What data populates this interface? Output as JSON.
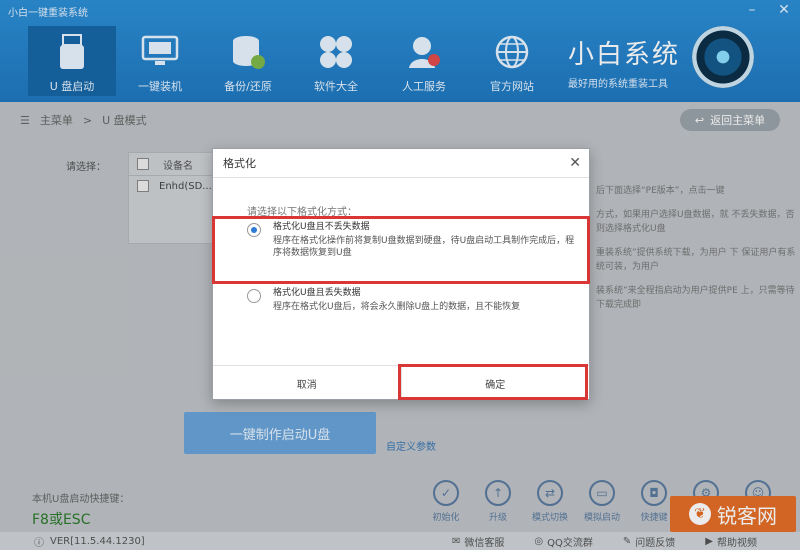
{
  "window": {
    "title": "小白一键重装系统"
  },
  "nav": {
    "items": [
      {
        "label": "U 盘启动",
        "icon": "usb-drive-icon",
        "active": true
      },
      {
        "label": "一键装机",
        "icon": "monitor-icon",
        "active": false
      },
      {
        "label": "备份/还原",
        "icon": "database-icon",
        "active": false
      },
      {
        "label": "软件大全",
        "icon": "apps-icon",
        "active": false
      },
      {
        "label": "人工服务",
        "icon": "support-person-icon",
        "active": false
      },
      {
        "label": "官方网站",
        "icon": "globe-icon",
        "active": false
      }
    ]
  },
  "brand": {
    "name": "小白系统",
    "slogan": "最好用的系统重装工具"
  },
  "breadcrumb": {
    "home": "主菜单",
    "separator": ">",
    "current": "U 盘模式",
    "back_label": "返回主菜单"
  },
  "device_panel": {
    "label": "请选择：",
    "header": "设备名",
    "row": "Enhd(SD..."
  },
  "side_description": {
    "paragraphs": [
      "后下面选择“PE版本”，点击一键",
      "方式，如果用户选择U盘数据，就 不丢失数据，否则选择格式化U盘",
      "重装系统”提供系统下载，为用户 下 保证用户有系统可装，为用户",
      "装系统”来全程指启动为用户提供PE 上，只需等待下载完成即"
    ]
  },
  "main_button": {
    "label": "一键制作启动U盘",
    "params_link": "自定义参数"
  },
  "hotkeys": {
    "label": "本机U盘启动快捷键：",
    "key": "F8或ESC"
  },
  "tools": [
    {
      "label": "初始化",
      "icon": "check-circle-icon"
    },
    {
      "label": "升级",
      "icon": "arrow-up-icon"
    },
    {
      "label": "模式切换",
      "icon": "mode-switch-icon"
    },
    {
      "label": "模拟启动",
      "icon": "simulate-boot-icon"
    },
    {
      "label": "快捷键",
      "icon": "mouse-icon"
    },
    {
      "label": "",
      "icon": "gear-icon"
    },
    {
      "label": "",
      "icon": "user-icon"
    }
  ],
  "status": {
    "version": "VER[11.5.44.1230]",
    "links": [
      {
        "label": "微信客服",
        "icon": "chat-icon"
      },
      {
        "label": "QQ交流群",
        "icon": "qq-icon"
      },
      {
        "label": "问题反馈",
        "icon": "feedback-icon"
      },
      {
        "label": "帮助视频",
        "icon": "video-icon"
      }
    ]
  },
  "watermark": {
    "text": "锐客网",
    "icon": "leaf-logo-icon"
  },
  "dialog": {
    "title": "格式化",
    "prompt": "请选择以下格式化方式：",
    "option1": {
      "label": "格式化U盘且不丢失数据",
      "desc": "程序在格式化操作前将复制U盘数据到硬盘，待U盘启动工具制作完成后，程序将数据恢复到U盘",
      "selected": true
    },
    "option2": {
      "label": "格式化U盘且丢失数据",
      "desc": "程序在格式化U盘后，将会永久删除U盘上的数据，且不能恢复",
      "selected": false
    },
    "cancel_label": "取消",
    "confirm_label": "确定",
    "highlight_color": "#d93636"
  }
}
